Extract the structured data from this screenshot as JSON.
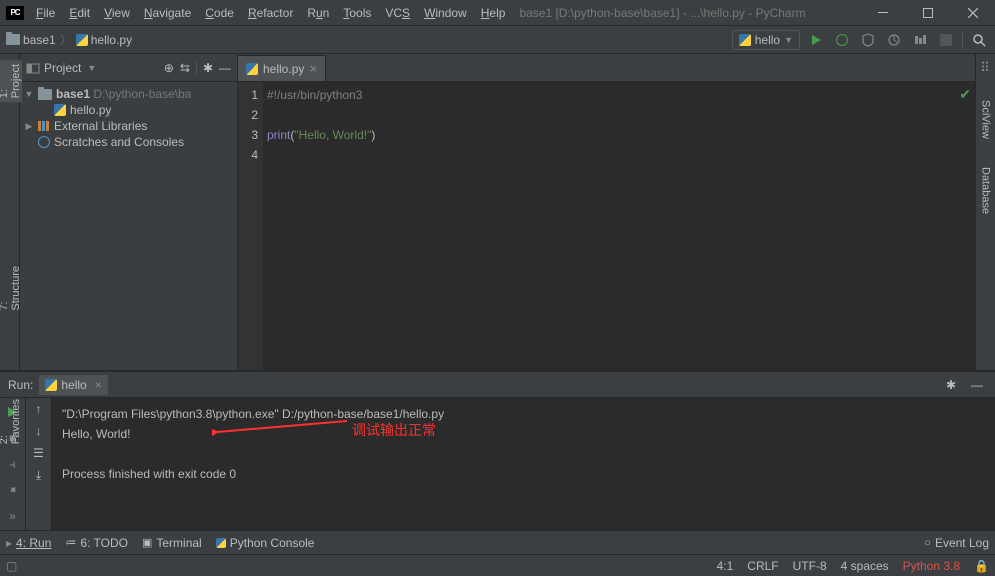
{
  "title_path": "base1 [D:\\python-base\\base1] - ...\\hello.py - PyCharm",
  "menu": {
    "file": "File",
    "edit": "Edit",
    "view": "View",
    "navigate": "Navigate",
    "code": "Code",
    "refactor": "Refactor",
    "run": "Run",
    "tools": "Tools",
    "vcs": "VCS",
    "window": "Window",
    "help": "Help"
  },
  "breadcrumb": {
    "project": "base1",
    "file": "hello.py"
  },
  "run_config_name": "hello",
  "project_pane": {
    "title": "Project",
    "root": "base1",
    "root_path": "D:\\python-base\\ba",
    "file": "hello.py",
    "ext_libs": "External Libraries",
    "scratches": "Scratches and Consoles"
  },
  "editor": {
    "tab": "hello.py",
    "lines": [
      "1",
      "2",
      "3",
      "4"
    ],
    "shebang_text": "#!/usr/bin/python3",
    "print_fn": "print",
    "print_open": "(",
    "print_str": "\"Hello, World!\"",
    "print_close": ")"
  },
  "right_tabs": [
    "SciView",
    "Database"
  ],
  "left_tabs": {
    "project": "1: Project",
    "structure": "7: Structure",
    "favorites": "2: Favorites"
  },
  "run_panel": {
    "prefix": "Run:",
    "tab_label": "hello",
    "cmd": "\"D:\\Program Files\\python3.8\\python.exe\" D:/python-base/base1/hello.py",
    "output": "Hello, World!",
    "exit": "Process finished with exit code 0",
    "annotation": "调试输出正常"
  },
  "tool_windows": {
    "run": "4: Run",
    "todo": "6: TODO",
    "terminal": "Terminal",
    "pyconsole": "Python Console",
    "event_log": "Event Log"
  },
  "status": {
    "pos": "4:1",
    "eol": "CRLF",
    "enc": "UTF-8",
    "indent": "4 spaces",
    "interp": "Python 3.8"
  }
}
